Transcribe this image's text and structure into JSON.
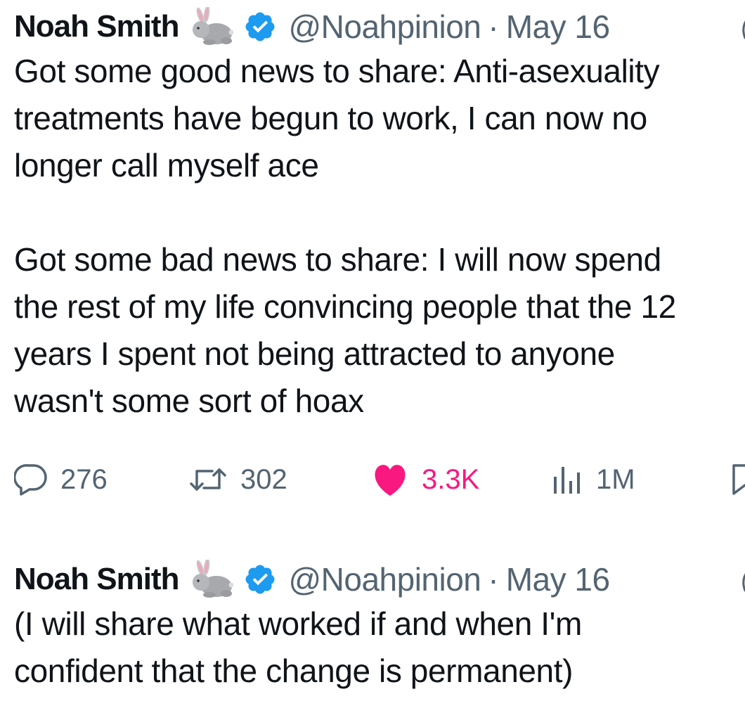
{
  "tweets": [
    {
      "name": "Noah Smith",
      "handle": "@Noahpinion",
      "separator": "·",
      "date": "May 16",
      "name_emoji_icon": "rabbit-icon",
      "verified_icon": "verified-badge-icon",
      "body": "Got some good news to share: Anti-asexuality\ntreatments have begun to work, I can now no\nlonger call myself ace\n\nGot some bad news to share: I will now spend\nthe rest of my life convincing people that the 12\nyears I spent not being attracted to anyone\nwasn't some sort of hoax",
      "actions": {
        "replies": "276",
        "retweets": "302",
        "likes": "3.3K",
        "views": "1M"
      }
    },
    {
      "name": "Noah Smith",
      "handle": "@Noahpinion",
      "separator": "·",
      "date": "May 16",
      "name_emoji_icon": "rabbit-icon",
      "verified_icon": "verified-badge-icon",
      "body": "(I will share what worked if and when I'm\nconfident that the change is permanent)"
    }
  ],
  "colors": {
    "text": "#0f1419",
    "secondary": "#536471",
    "verified": "#1d9bf0",
    "like": "#f91880"
  }
}
